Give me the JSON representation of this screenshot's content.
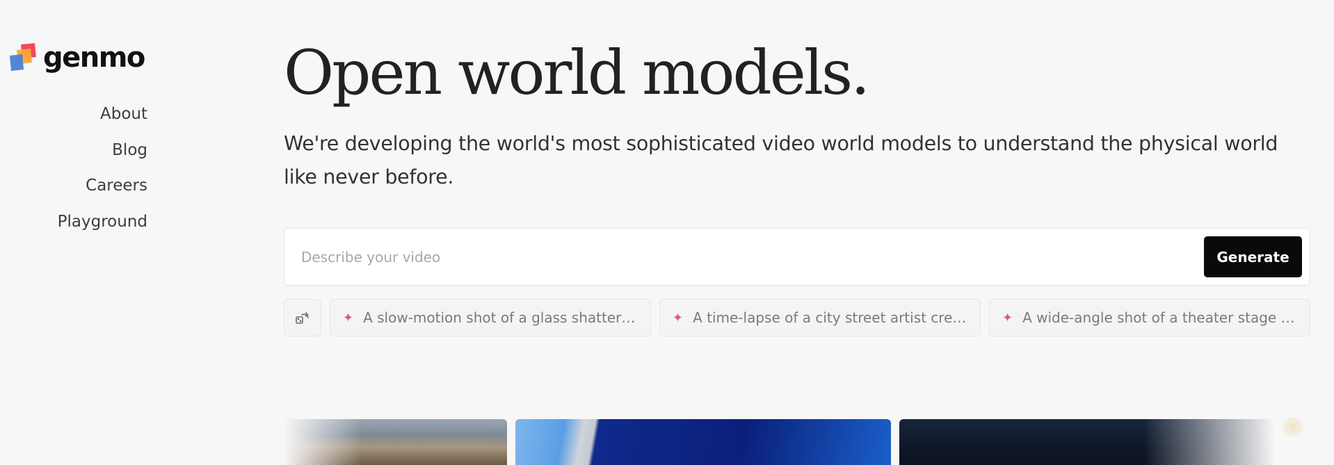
{
  "brand": {
    "name": "genmo",
    "colors": {
      "red": "#ef4a5b",
      "orange": "#f6a93a",
      "blue": "#4a7fd8",
      "dark": "#111111"
    }
  },
  "nav": {
    "items": [
      {
        "label": "About"
      },
      {
        "label": "Blog"
      },
      {
        "label": "Careers"
      },
      {
        "label": "Playground"
      }
    ]
  },
  "hero": {
    "title": "Open world models.",
    "subtitle": "We're developing the world's most sophisticated video world models to understand the physical world like never before."
  },
  "prompt": {
    "placeholder": "Describe your video",
    "value": "",
    "generate_label": "Generate"
  },
  "suggestions": {
    "shuffle_icon": "shuffle-icon",
    "items": [
      {
        "icon": "sparkle-icon",
        "text": "A slow-motion shot of a glass shattering on the floor"
      },
      {
        "icon": "sparkle-icon",
        "text": "A time-lapse of a city street artist creating a mural"
      },
      {
        "icon": "sparkle-icon",
        "text": "A wide-angle shot of a theater stage filled with performers"
      }
    ]
  },
  "gallery": {
    "thumbnails": [
      {
        "name": "mountain-landscape-video"
      },
      {
        "name": "sky-structure-video"
      },
      {
        "name": "night-forest-video"
      }
    ]
  }
}
